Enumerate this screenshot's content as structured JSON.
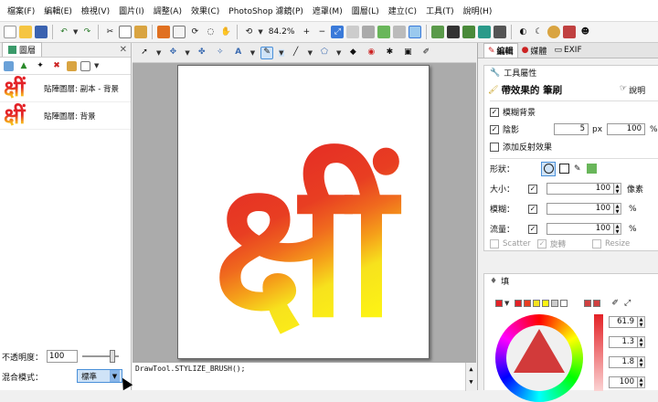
{
  "menu": [
    "檔案(F)",
    "編輯(E)",
    "檢視(V)",
    "圖片(I)",
    "調整(A)",
    "效果(C)",
    "PhotoShop 濾鏡(P)",
    "遮罩(M)",
    "圖層(L)",
    "建立(C)",
    "工具(T)",
    "說明(H)"
  ],
  "toolbar": {
    "zoom": "84.2%"
  },
  "layers_panel": {
    "tab_label": "圖層",
    "close_glyph": "✕",
    "layers": [
      {
        "name": "貼陣圖層: 副本 - 背景",
        "thumb": "क्षीं"
      },
      {
        "name": "貼陣圖層: 背景",
        "thumb": "क्षीं"
      }
    ],
    "opacity_label": "不透明度：",
    "opacity_value": "100",
    "blend_label": "混合模式：",
    "blend_value": "標準"
  },
  "canvas": {
    "glyph": "क्षीं",
    "gradient": [
      "#e32227",
      "#e83e22",
      "#f06a1e",
      "#f59f1a",
      "#f7e21d",
      "#fdf414"
    ]
  },
  "script_panel": {
    "text": "DrawTool.STYLIZE_BRUSH();"
  },
  "right_tabs": [
    {
      "label": "編輯"
    },
    {
      "label": "媒體"
    },
    {
      "label": "EXIF"
    }
  ],
  "tool_props": {
    "header": "工具屬性",
    "brush_title": "帶效果的 筆刷",
    "help": "說明",
    "blur_bg": "模糊背景",
    "shadow": "陰影",
    "shadow_px": "5",
    "shadow_unit": "px",
    "shadow_pct": "100",
    "pct": "%",
    "reflect": "添加反射效果",
    "shape_label": "形狀：",
    "size_label": "大小：",
    "size_value": "100",
    "size_unit": "像素",
    "blur_label": "模糊：",
    "blur_value": "100",
    "flow_label": "流量：",
    "flow_value": "100",
    "scatter": "Scatter",
    "rotate": "旋轉",
    "resize": "Resize"
  },
  "fill": {
    "header": "填",
    "swatches": [
      "#e32227",
      "#e32227",
      "#e83e22",
      "#f7e21d",
      "#fdf414",
      "#cccccc",
      "#ffffff"
    ],
    "values": [
      "61.9",
      "1.3",
      "1.8",
      "100"
    ]
  }
}
